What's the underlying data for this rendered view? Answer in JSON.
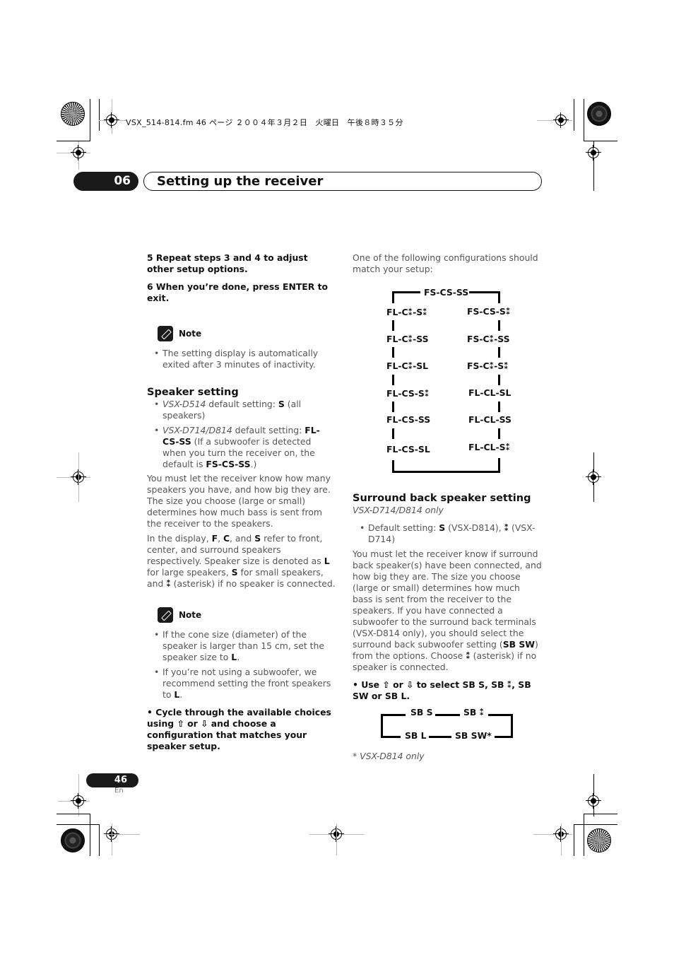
{
  "print_header": "VSX_514-814.fm  46 ページ  ２００４年３月２日　火曜日　午後８時３５分",
  "chapter": {
    "number": "06",
    "title": "Setting up the receiver"
  },
  "left_column": {
    "step5": "5    Repeat steps 3 and 4 to adjust other setup options.",
    "step6": "6    When you’re done, press ENTER to exit.",
    "note1": {
      "label": "Note",
      "items": [
        "The setting display is automatically exited after 3 minutes of inactivity."
      ]
    },
    "speaker_setting": {
      "heading": "Speaker setting",
      "bullet1": {
        "model": "VSX-D514",
        "text": " default setting: ",
        "value": "S",
        "suffix": " (all speakers)"
      },
      "bullet2": {
        "model": "VSX-D714/D814",
        "text": " default setting: ",
        "value": "FL-CS-SS",
        "suffix": " (If a subwoofer is detected when you turn the receiver on, the default is ",
        "value2": "FS-CS-SS",
        "suffix2": ".)"
      },
      "para1": "You must let the receiver know how many speakers you have, and how big they are. The size you choose (large or small) determines how much bass is sent from the receiver to the speakers.",
      "para2": {
        "t1": "In the display, ",
        "F": "F",
        "t2": ", ",
        "C": "C",
        "t3": ", and ",
        "S": "S",
        "t4": " refer to front, center, and surround speakers respectively. Speaker size is denoted as ",
        "L": "L",
        "t5": " for large speakers, ",
        "S2": "S",
        "t6": " for small speakers, and ",
        "ast": "⁑",
        "t7": " (asterisk) if no speaker is connected."
      }
    },
    "note2": {
      "label": "Note",
      "item1": {
        "text": "If the cone size (diameter) of the speaker is larger than 15 cm, set the speaker size to ",
        "value": "L",
        "end": "."
      },
      "item2": {
        "text": "If you’re not using a subwoofer, we recommend setting the front speakers to ",
        "value": "L",
        "end": "."
      }
    },
    "cycle_instruction": "•    Cycle through the available choices using ⇧ or ⇩ and choose a configuration that matches your speaker setup."
  },
  "right_column": {
    "intro": "One of the following configurations should match your setup:",
    "config_diagram": {
      "top": "FS-CS-SS",
      "left": [
        "FL-C⁑-S⁑",
        "FL-C⁑-SS",
        "FL-C⁑-SL",
        "FL-CS-S⁑",
        "FL-CS-SS",
        "FL-CS-SL"
      ],
      "right": [
        "FS-CS-S⁑",
        "FS-C⁑-SS",
        "FS-C⁑-S⁑",
        "FL-CL-SL",
        "FL-CL-SS",
        "FL-CL-S⁑"
      ]
    },
    "surround_back": {
      "heading": "Surround back speaker setting",
      "subtitle": "VSX-D714/D814 only",
      "bullet": {
        "t1": "Default setting: ",
        "S": "S",
        "t2": " (VSX-D814), ",
        "ast": "⁑",
        "t3": " (VSX-D714)"
      },
      "para": {
        "t1": "You must let the receiver know if surround back speaker(s) have been connected, and how big they are. The size you choose (large or small) determines how much bass is sent from the receiver to the speakers. If you have connected a subwoofer to the surround back terminals (VSX-D814 only), you should select the surround back subwoofer setting (",
        "sbsw": "SB SW",
        "t2": ") from the options. Choose ",
        "ast": "⁑",
        "t3": " (asterisk) if no speaker is connected."
      },
      "instruction": "•    Use ⇧ or ⇩ to select SB S, SB ⁑, SB SW or SB L.",
      "sb_diagram": {
        "top_left": "SB S",
        "top_right": "SB ⁑",
        "bottom_left": "SB L",
        "bottom_right": "SB SW*"
      },
      "footnote": "* VSX-D814 only"
    }
  },
  "footer": {
    "page_number": "46",
    "language": "En"
  }
}
